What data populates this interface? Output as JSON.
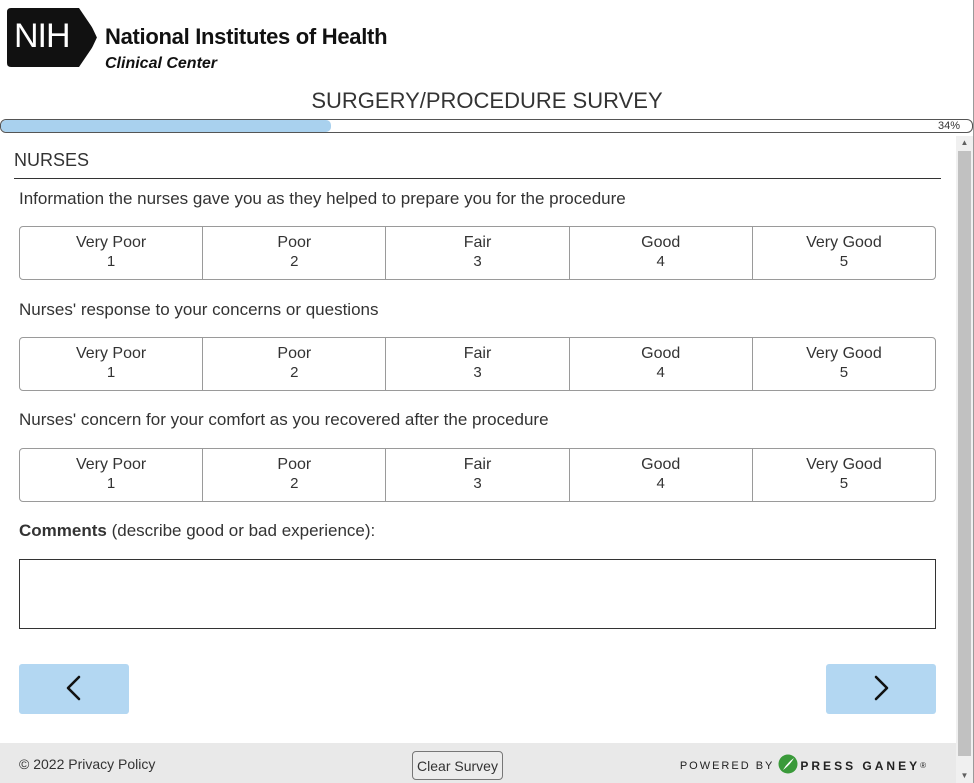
{
  "header": {
    "logo_mark": "NIH",
    "org_name": "National Institutes of Health",
    "org_sub": "Clinical Center",
    "survey_title": "SURGERY/PROCEDURE SURVEY"
  },
  "progress": {
    "percent": 34,
    "label": "34%"
  },
  "section": {
    "title": "NURSES"
  },
  "questions": [
    {
      "text": "Information the nurses gave you as they helped to prepare you for the procedure"
    },
    {
      "text": "Nurses' response to your concerns or questions"
    },
    {
      "text": "Nurses' concern for your comfort as you recovered after the procedure"
    }
  ],
  "scale_options": [
    {
      "label": "Very Poor",
      "value": "1"
    },
    {
      "label": "Poor",
      "value": "2"
    },
    {
      "label": "Fair",
      "value": "3"
    },
    {
      "label": "Good",
      "value": "4"
    },
    {
      "label": "Very Good",
      "value": "5"
    }
  ],
  "comments": {
    "label_bold": "Comments",
    "label_rest": " (describe good or bad experience):",
    "value": ""
  },
  "navigation": {
    "prev_icon": "chevron-left-icon",
    "next_icon": "chevron-right-icon"
  },
  "footer": {
    "copyright": "© 2022 Privacy Policy",
    "clear_label": "Clear Survey",
    "powered_by": "POWERED BY",
    "brand": "PRESS GANEY",
    "brand_mark": "®"
  },
  "colors": {
    "accent": "#b3d7f2",
    "progress_fill": "#a9d1ee",
    "text": "#333333",
    "press_ganey_green": "#3a9a3a"
  }
}
